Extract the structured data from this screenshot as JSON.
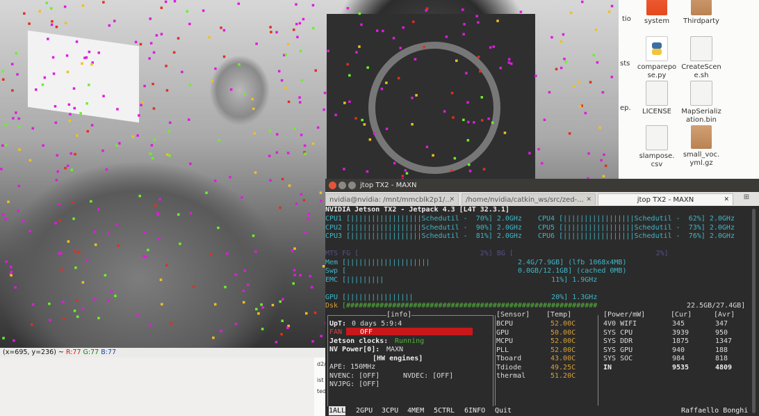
{
  "file_manager": {
    "items": [
      {
        "label": "system",
        "type": "folder"
      },
      {
        "label": "Thirdparty",
        "type": "folder-tp"
      },
      {
        "label": "comparepo se.py",
        "type": "python"
      },
      {
        "label": "CreateScen e.sh",
        "type": "doc"
      },
      {
        "label": "LICENSE",
        "type": "doc"
      },
      {
        "label": "MapSerializ ation.bin",
        "type": "binary"
      },
      {
        "label": "slampose. csv",
        "type": "doc"
      },
      {
        "label": "small_voc. yml.gz",
        "type": "archive"
      }
    ],
    "cut_labels": [
      "tio",
      "sts",
      "ep."
    ],
    "sidebar_cut": [
      "d2/",
      "ist",
      "ted"
    ]
  },
  "viewer": {
    "status_coords": "(x=695, y=236) ~",
    "status_r": "R:77",
    "status_g": "G:77",
    "status_b": "B:77"
  },
  "terminal": {
    "title": "jtop TX2 - MAXN",
    "tabs": [
      {
        "label": "nvidia@nvidia: /mnt/mmcblk2p1/...",
        "active": false
      },
      {
        "label": "/home/nvidia/catkin_ws/src/zed-...",
        "active": false
      },
      {
        "label": "jtop TX2 - MAXN",
        "active": true
      }
    ],
    "header": "NVIDIA Jetson TX2 - Jetpack 4.3 [L4T 32.3.1]",
    "cpu_rows": [
      {
        "left": "CPU1 [|||||||||||||||||Schedutil -  70%] 2.0GHz",
        "right": "CPU4 [|||||||||||||||||Schedutil -  62%] 2.0GHz"
      },
      {
        "left": "CPU2 [|||||||||||||||||Schedutil -  90%] 2.0GHz",
        "right": "CPU5 [|||||||||||||||||Schedutil -  73%] 2.0GHz"
      },
      {
        "left": "CPU3 [|||||||||||||||||Schedutil -  81%] 2.0GHz",
        "right": "CPU6 [|||||||||||||||||Schedutil -  76%] 2.0GHz"
      }
    ],
    "mts_line": "MTS FG [                             2%] BG [                                  2%]",
    "mem_line": "Mem [||||||||||||||||||||                     2.4G/7.9GB] (lfb 1068x4MB)",
    "swp_line": "Swp [                                         0.0GB/12.1GB] (cached 0MB)",
    "emc_line": "EMC [|||||||||                                        11%] 1.9GHz",
    "gpu_line": "GPU [||||||||||||||||                                 20%] 1.3GHz",
    "dsk_label": "Dsk",
    "dsk_bar": "[############################################################",
    "dsk_value": "22.5GB/27.4GB]",
    "info": {
      "title": "[info]",
      "upt_label": "UpT:",
      "upt_value": "0 days 5:9:4",
      "fan_label": "FAN",
      "fan_value": "OFF",
      "jetson_clocks_label": "Jetson clocks:",
      "jetson_clocks_value": "Running",
      "nvpower_label": "NV Power[0]:",
      "nvpower_value": "MAXN",
      "hw_title": "[HW engines]",
      "ape": "APE: 150MHz",
      "nvenc": "NVENC: [OFF]",
      "nvdec": "NVDEC: [OFF]",
      "nvjpg": "NVJPG: [OFF]"
    },
    "sensors": {
      "headers": [
        "[Sensor]",
        "[Temp]"
      ],
      "rows": [
        [
          "BCPU",
          "52.00C"
        ],
        [
          "GPU",
          "50.00C"
        ],
        [
          "MCPU",
          "52.00C"
        ],
        [
          "PLL",
          "52.00C"
        ],
        [
          "Tboard",
          "43.00C"
        ],
        [
          "Tdiode",
          "49.25C"
        ],
        [
          "thermal",
          "51.20C"
        ]
      ]
    },
    "power": {
      "headers": [
        "[Power/mW]",
        "[Cur]",
        "[Avr]"
      ],
      "rows": [
        [
          "4V0 WIFI",
          "345",
          "347"
        ],
        [
          "SYS CPU",
          "3939",
          "950"
        ],
        [
          "SYS DDR",
          "1875",
          "1347"
        ],
        [
          "SYS GPU",
          "940",
          "188"
        ],
        [
          "SYS SOC",
          "984",
          "818"
        ],
        [
          "IN",
          "9535",
          "4809"
        ]
      ]
    },
    "menu": [
      {
        "num": "1",
        "label": "ALL"
      },
      {
        "num": "2",
        "label": "GPU"
      },
      {
        "num": "3",
        "label": "CPU"
      },
      {
        "num": "4",
        "label": "MEM"
      },
      {
        "num": "5",
        "label": "CTRL"
      },
      {
        "num": "6",
        "label": "INFO"
      }
    ],
    "quit": "Quit",
    "author": "Raffaello Bonghi",
    "colors": {
      "fan_bar": "#c8181b",
      "cyan": "#3fb8c8",
      "green": "#53b63b",
      "yellow": "#d7a13b"
    }
  }
}
